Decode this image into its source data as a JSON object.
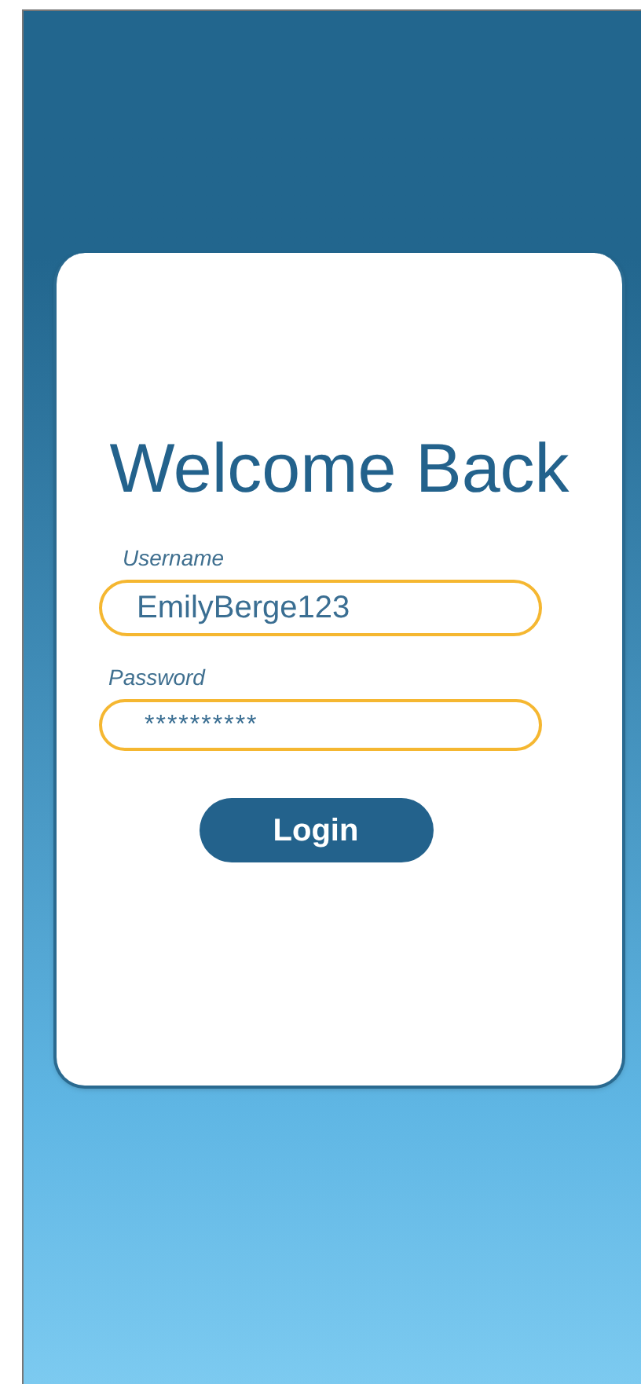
{
  "title": "Welcome Back",
  "fields": [
    {
      "label": "Username",
      "value": "EmilyBerge123",
      "kind": "text"
    },
    {
      "label": "Password",
      "value": "**********",
      "kind": "password"
    }
  ],
  "button": {
    "label": "Login"
  }
}
